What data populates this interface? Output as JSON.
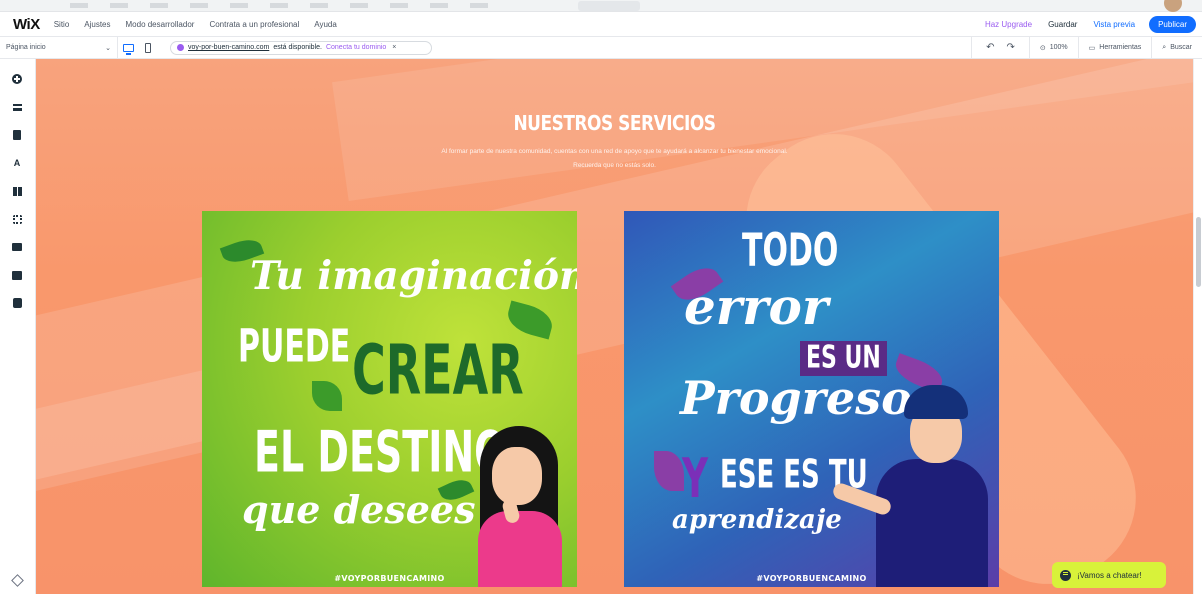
{
  "topbar": {
    "logo": "WiX",
    "menu": [
      "Sitio",
      "Ajustes",
      "Modo desarrollador",
      "Contrata a un profesional",
      "Ayuda"
    ],
    "upgrade": "Haz Upgrade",
    "save": "Guardar",
    "preview": "Vista previa",
    "publish": "Publicar"
  },
  "subbar": {
    "page": "Página inicio",
    "domain": "voy-por-buen-camino.com",
    "domain_status": "está disponible.",
    "connect": "Conecta tu dominio",
    "close": "×",
    "zoom": "100%",
    "tools": "Herramientas",
    "search": "Buscar"
  },
  "section": {
    "title": "NUESTROS SERVICIOS",
    "desc1": "Al formar parte de nuestra comunidad, cuentas con una red de apoyo que te ayudará a alcanzar tu bienestar emocional.",
    "desc2": "Recuerda que no estás solo."
  },
  "poster1": {
    "line1": "Tu imaginación",
    "line2a": "PUEDE",
    "line2b": "CREAR",
    "line3": "EL DESTINO",
    "line4": "que desees",
    "hashtag": "#VOYPORBUENCAMINO"
  },
  "poster2": {
    "line1": "TODO",
    "line2": "error",
    "line3": "ES UN",
    "line4": "Progreso",
    "line5a": "Y",
    "line5b": "ESE ES TU",
    "line6": "aprendizaje",
    "hashtag": "#VOYPORBUENCAMINO"
  },
  "chat": {
    "label": "¡Vamos a chatear!"
  },
  "colors": {
    "accent": "#116dff",
    "upgrade": "#9a5cf0",
    "chat": "#d8f23a",
    "canvas": "#f9986c"
  }
}
